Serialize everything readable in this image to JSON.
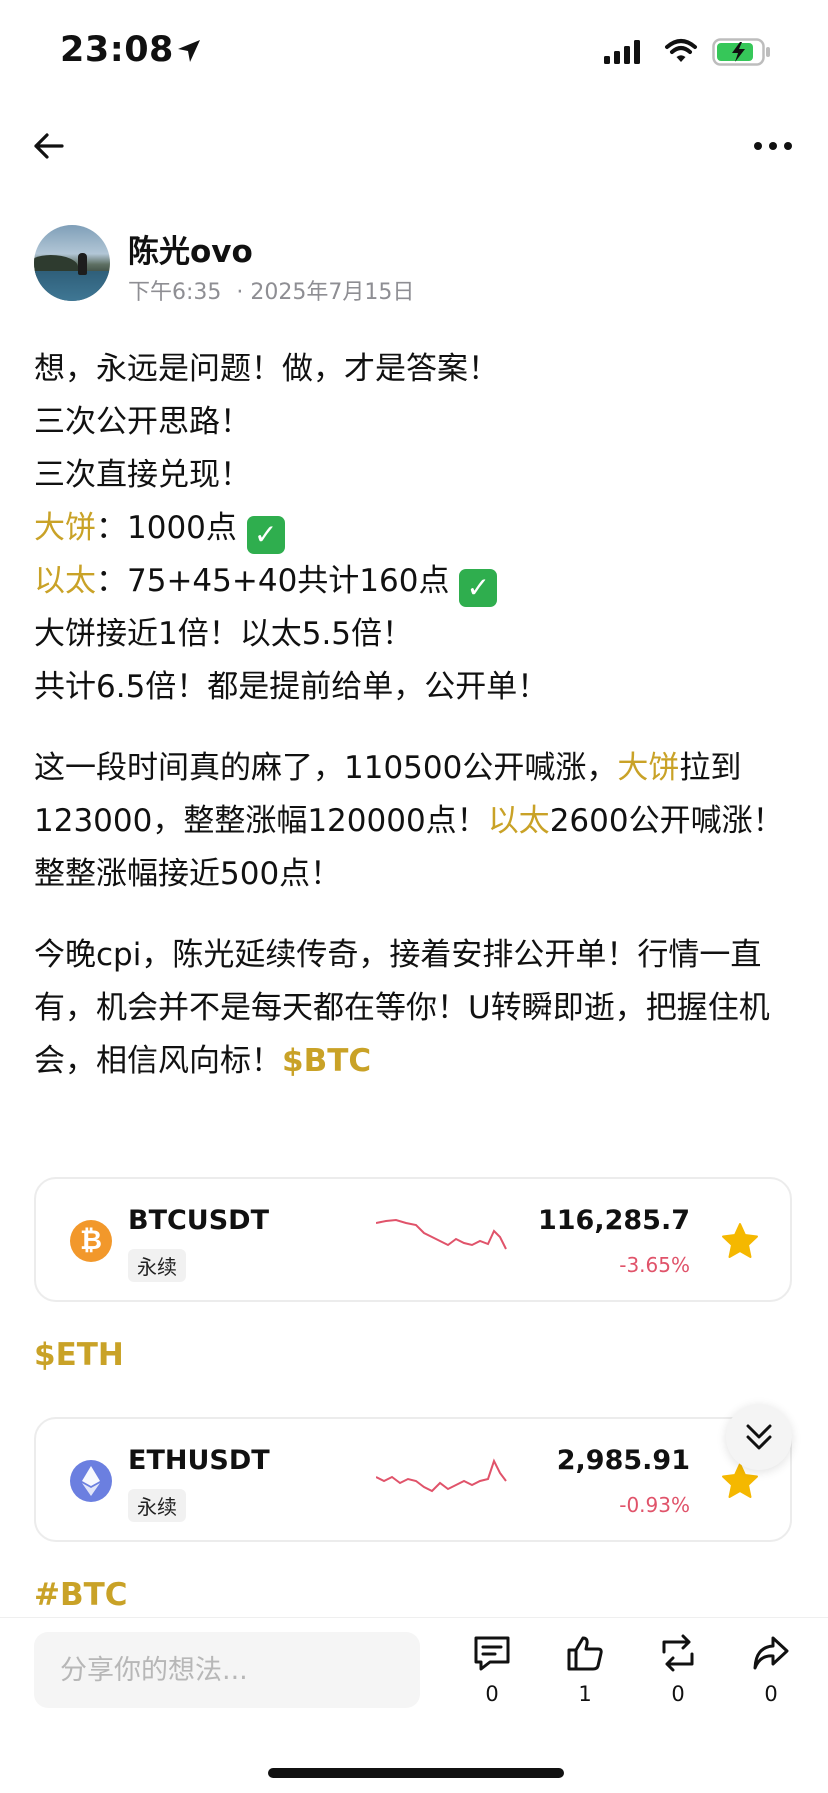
{
  "status_bar": {
    "time": "23:08",
    "battery_color": "#36c759"
  },
  "author": {
    "name": "陈光ovo",
    "time": "下午6:35",
    "date": "· 2025年7月15日"
  },
  "post": {
    "l1": "想，永远是问题！做，才是答案！",
    "l2": "三次公开思路！",
    "l3": "三次直接兑现！",
    "l4_hl": "大饼",
    "l4": "：1000点",
    "l5_hl": "以太",
    "l5": "：75+45+40共计160点",
    "l6": "大饼接近1倍！以太5.5倍！",
    "l7": "共计6.5倍！都是提前给单，公开单！",
    "p2_a": "这一段时间真的麻了，110500公开喊涨，",
    "p2_hl1": "大饼",
    "p2_b": "拉到123000，整整涨幅120000点！",
    "p2_hl2": "以太",
    "p2_c": "2600公开喊涨！整整涨幅接近500点！",
    "p3": "今晚cpi，陈光延续传奇，接着安排公开单！行情一直有，机会并不是每天都在等你！U转瞬即逝，把握住机会，相信风向标！",
    "p3_tag": "$BTC",
    "check_glyph": "✓"
  },
  "tickers": [
    {
      "symbol": "BTCUSDT",
      "type": "永续",
      "price": "116,285.7",
      "change": "-3.65%",
      "coin_glyph": "₿"
    },
    {
      "symbol": "ETHUSDT",
      "type": "永续",
      "price": "2,985.91",
      "change": "-0.93%"
    }
  ],
  "tags": {
    "eth": "$ETH",
    "btc": "#BTC"
  },
  "bottom": {
    "placeholder": "分享你的想法...",
    "comments": "0",
    "likes": "1",
    "reposts": "0",
    "shares": "0"
  },
  "colors": {
    "accent": "#c9a227",
    "negative": "#e0536a",
    "star": "#f5b800"
  }
}
